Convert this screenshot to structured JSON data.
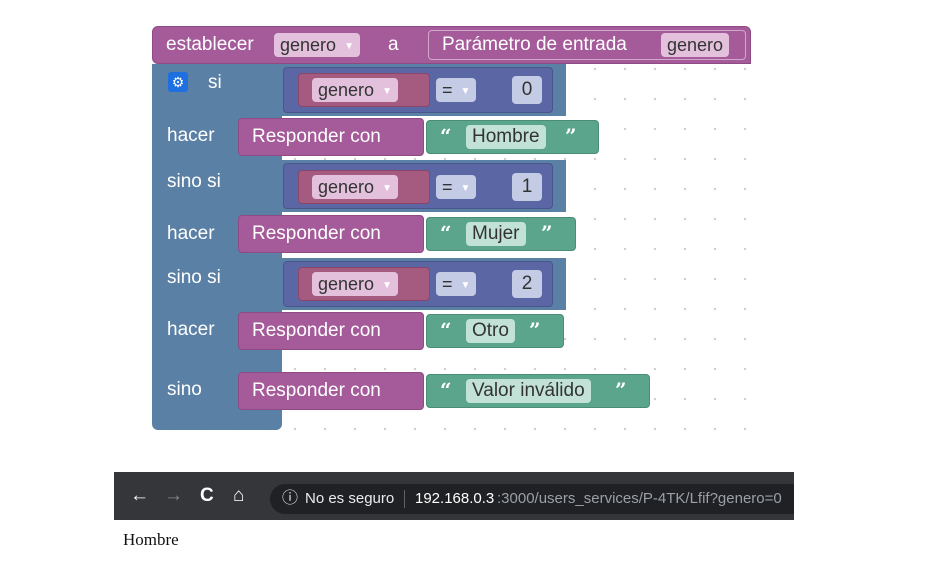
{
  "blocks": {
    "set": {
      "label": "establecer",
      "var": "genero",
      "to": "a",
      "param_label": "Parámetro de entrada",
      "param_value": "genero"
    },
    "if": {
      "si": "si",
      "hacer": "hacer",
      "sino_si": "sino si",
      "sino": "sino",
      "conditions": [
        {
          "var": "genero",
          "op": "=",
          "value": "0"
        },
        {
          "var": "genero",
          "op": "=",
          "value": "1"
        },
        {
          "var": "genero",
          "op": "=",
          "value": "2"
        }
      ],
      "responses": [
        {
          "label": "Responder con",
          "text": "Hombre"
        },
        {
          "label": "Responder con",
          "text": "Mujer"
        },
        {
          "label": "Responder con",
          "text": "Otro"
        },
        {
          "label": "Responder con",
          "text": "Valor inválido"
        }
      ]
    },
    "quote_open": "“",
    "quote_close": "”"
  },
  "browser": {
    "back": "←",
    "forward": "→",
    "reload": "C",
    "home": "⌂",
    "info_icon": "ⓘ",
    "security": "No es seguro",
    "url_host": "192.168.0.3",
    "url_rest": ":3000/users_services/P-4TK/Lfif?genero=0"
  },
  "page": {
    "body_text": "Hombre"
  },
  "colors": {
    "set_block": "#a55b99",
    "if_block": "#5b80a5",
    "compare": "#5b67a5",
    "variable": "#a55b80",
    "text_block": "#5ba58c"
  }
}
